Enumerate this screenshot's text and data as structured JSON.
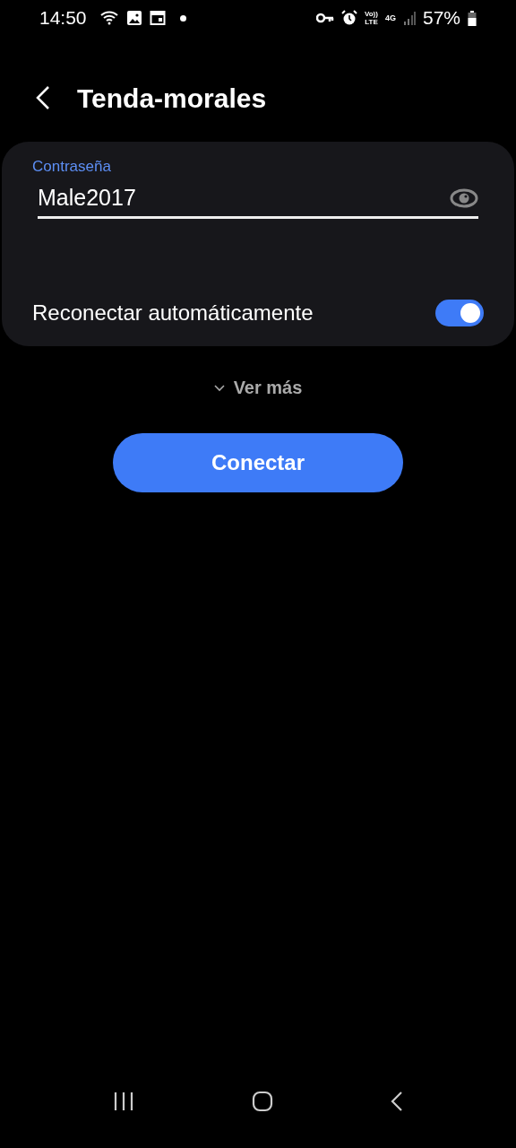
{
  "status_bar": {
    "time": "14:50",
    "volte_top": "Vo))",
    "volte_bottom": "LTE",
    "network": "4G",
    "battery": "57%"
  },
  "header": {
    "title": "Tenda-morales"
  },
  "password": {
    "label": "Contraseña",
    "value": "Male2017"
  },
  "auto_reconnect": {
    "label": "Reconectar automáticamente",
    "on": true
  },
  "see_more": {
    "label": "Ver más"
  },
  "connect_button": {
    "label": "Conectar"
  }
}
